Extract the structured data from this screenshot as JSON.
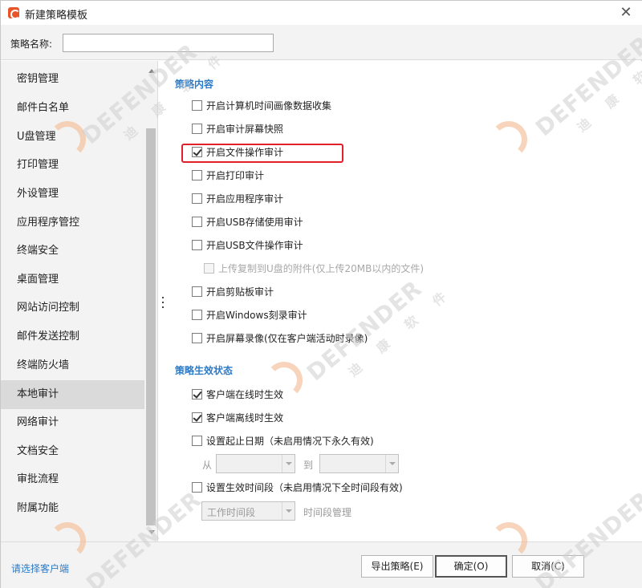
{
  "window": {
    "title": "新建策略模板",
    "close_icon": "close-icon"
  },
  "name_field": {
    "label": "策略名称:",
    "value": ""
  },
  "sidebar": {
    "items": [
      {
        "label": "密钥管理"
      },
      {
        "label": "邮件白名单"
      },
      {
        "label": "U盘管理"
      },
      {
        "label": "打印管理"
      },
      {
        "label": "外设管理"
      },
      {
        "label": "应用程序管控"
      },
      {
        "label": "终端安全"
      },
      {
        "label": "桌面管理"
      },
      {
        "label": "网站访问控制"
      },
      {
        "label": "邮件发送控制"
      },
      {
        "label": "终端防火墙"
      },
      {
        "label": "本地审计"
      },
      {
        "label": "网络审计"
      },
      {
        "label": "文档安全"
      },
      {
        "label": "审批流程"
      },
      {
        "label": "附属功能"
      }
    ],
    "selected": "本地审计"
  },
  "policy_content": {
    "title": "策略内容",
    "options": [
      {
        "label": "开启计算机时间画像数据收集",
        "checked": false
      },
      {
        "label": "开启审计屏幕快照",
        "checked": false
      },
      {
        "label": "开启文件操作审计",
        "checked": true
      },
      {
        "label": "开启打印审计",
        "checked": false
      },
      {
        "label": "开启应用程序审计",
        "checked": false
      },
      {
        "label": "开启USB存储使用审计",
        "checked": false
      },
      {
        "label": "开启USB文件操作审计",
        "checked": false
      },
      {
        "label": "上传复制到U盘的附件(仅上传20MB以内的文件)",
        "checked": false,
        "disabled": true
      },
      {
        "label": "开启剪贴板审计",
        "checked": false
      },
      {
        "label": "开启Windows刻录审计",
        "checked": false
      },
      {
        "label": "开启屏幕录像(仅在客户端活动时录像)",
        "checked": false
      }
    ]
  },
  "policy_status": {
    "title": "策略生效状态",
    "online": {
      "label": "客户端在线时生效",
      "checked": true
    },
    "offline": {
      "label": "客户端离线时生效",
      "checked": true
    },
    "date_range": {
      "label": "设置起止日期（未启用情况下永久有效)",
      "checked": false
    },
    "from_label": "从",
    "to_label": "到",
    "from_value": "",
    "to_value": "",
    "time_period": {
      "label": "设置生效时间段（未启用情况下全时间段有效)",
      "checked": false
    },
    "time_select_value": "工作时间段",
    "time_manage_link": "时间段管理"
  },
  "footer": {
    "select_client": "请选择客户端",
    "export_button": "导出策略(E)",
    "ok_button": "确定(O)",
    "cancel_button": "取消(C)"
  },
  "watermark": {
    "brand": "DEFENDER",
    "cn": "迪 康 软 件"
  },
  "colors": {
    "accent_blue": "#2b7ac8",
    "highlight_red": "#e0202a",
    "selected_item_bg": "#dadada",
    "panel_bg": "#f3f3f3"
  }
}
